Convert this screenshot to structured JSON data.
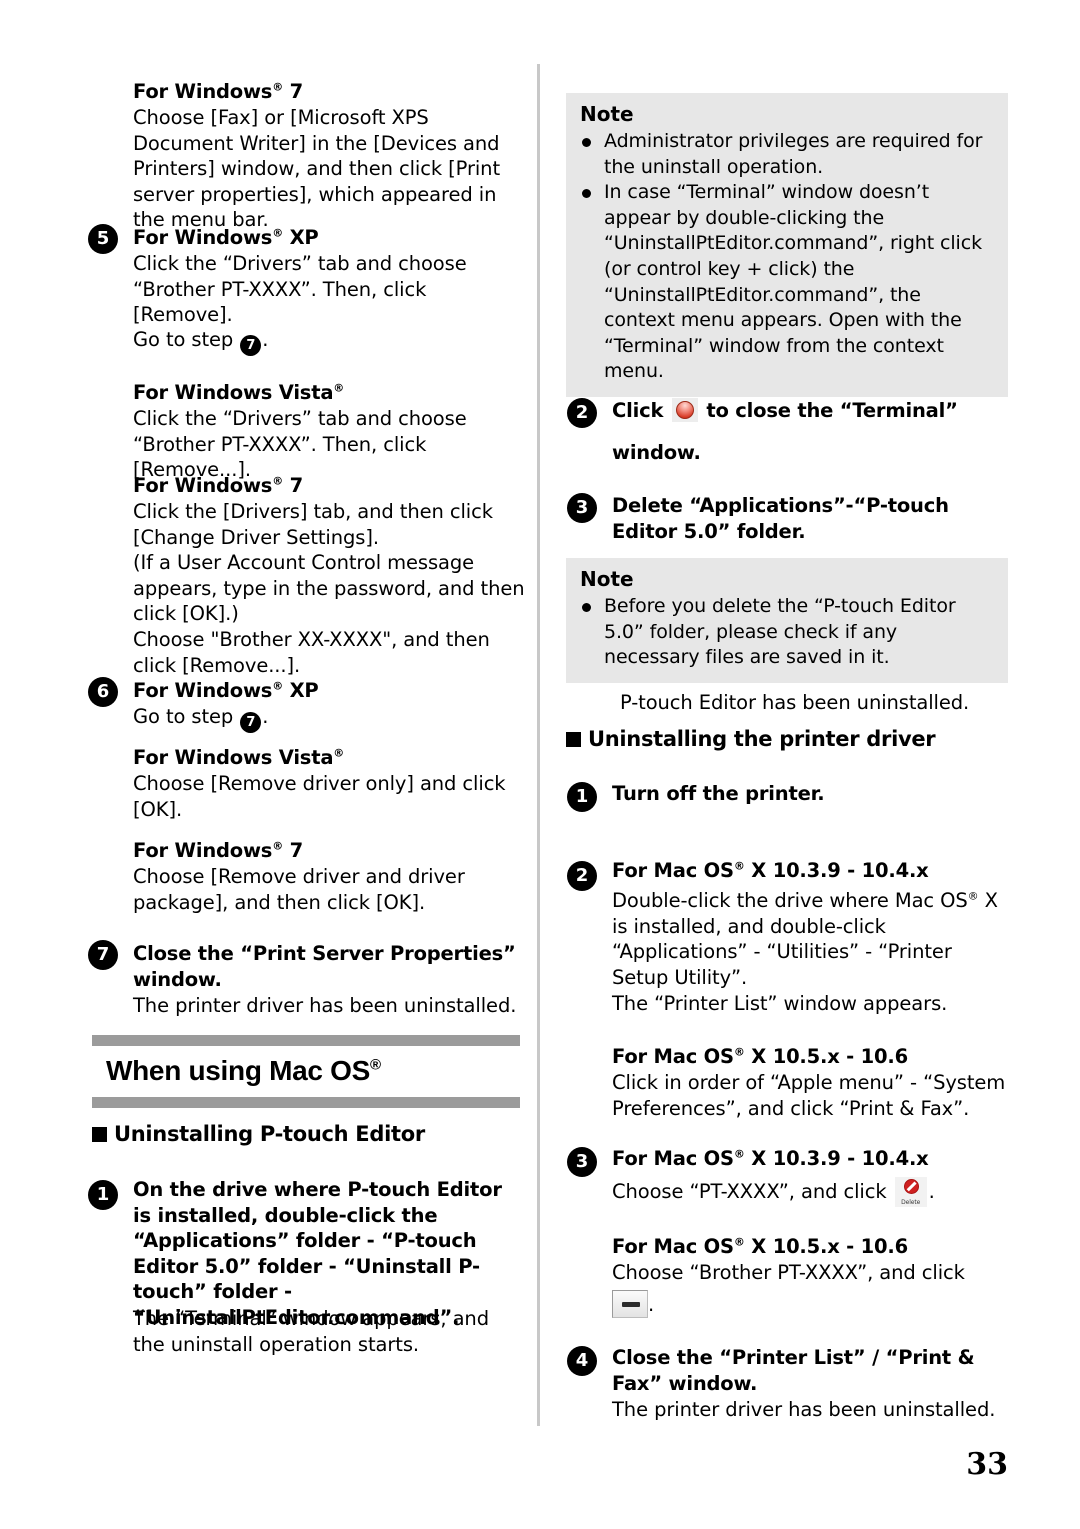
{
  "page": {
    "number": "33"
  },
  "left_column": {
    "win7_first": {
      "heading_pre": "For Windows",
      "heading_reg": "®",
      "heading_post": " 7",
      "body": "Choose [Fax] or [Microsoft XPS Document Writer] in the [Devices and Printers] window, and then click [Print server properties], which appeared in the menu bar."
    },
    "step5": {
      "number": "5",
      "winxp_heading_pre": "For Windows",
      "winxp_heading_post": " XP",
      "winxp_body": "Click the “Drivers” tab and choose “Brother PT-XXXX”. Then, click [Remove].",
      "goto_pre": "Go to step ",
      "goto_step": "7",
      "goto_post": ".",
      "vista_heading_pre": "For Windows Vista",
      "vista_body": "Click the “Drivers” tab and choose “Brother PT-XXXX”. Then, click [Remove...].",
      "win7_heading_pre": "For Windows",
      "win7_heading_post": " 7",
      "win7_body": "Click the [Drivers] tab, and then click [Change Driver Settings].\n(If a User Account Control message appears, type in the password, and then click [OK].)\nChoose \"Brother XX-XXXX\", and then click [Remove...]."
    },
    "step6": {
      "number": "6",
      "winxp_heading_pre": "For Windows",
      "winxp_heading_post": " XP",
      "goto_pre": "Go to step ",
      "goto_step": "7",
      "goto_post": ".",
      "vista_heading_pre": "For Windows Vista",
      "vista_body": "Choose [Remove driver only] and click [OK].",
      "win7_heading_pre": "For Windows",
      "win7_heading_post": " 7",
      "win7_body": "Choose [Remove driver and driver package], and then click [OK]."
    },
    "step7": {
      "number": "7",
      "heading": "Close the “Print Server Properties” window.",
      "body": "The printer driver has been uninstalled."
    },
    "banner": {
      "title_pre": "When using Mac OS",
      "title_reg": "®"
    },
    "section_ptouch": {
      "title": "Uninstalling P-touch Editor"
    },
    "mac_step1": {
      "number": "1",
      "heading": "On the drive where P-touch Editor is installed, double-click the “Applications” folder - “P-touch Editor 5.0” folder - “Uninstall P-touch” folder - “UninstallPtEditor.command”.",
      "body": "The “Terminal” window appears, and the uninstall operation starts."
    }
  },
  "right_column": {
    "note1": {
      "title": "Note",
      "items": [
        "Administrator privileges are required for the uninstall operation.",
        "In case “Terminal” window doesn’t appear by double-clicking the “UninstallPtEditor.command”, right click (or control key + click) the “UninstallPtEditor.command”, the context menu appears. Open with the “Terminal” window from the context menu."
      ]
    },
    "step2": {
      "number": "2",
      "text_pre": "Click ",
      "icon": "mac-close-button-icon",
      "text_mid": " to close the “Terminal”",
      "text_post": "window."
    },
    "step3": {
      "number": "3",
      "heading": "Delete “Applications”-“P-touch Editor 5.0” folder."
    },
    "note2": {
      "title": "Note",
      "items": [
        "Before you delete the “P-touch Editor 5.0” folder, please check if any necessary files are saved in it."
      ]
    },
    "uninstalled_msg": "P-touch Editor has been uninstalled.",
    "section_driver": {
      "title": "Uninstalling the printer driver"
    },
    "drv_step1": {
      "number": "1",
      "heading": "Turn off the printer."
    },
    "drv_step2": {
      "number": "2",
      "mac103_heading_pre": "For Mac OS",
      "mac103_heading_post": " X 10.3.9 - 10.4.x",
      "mac103_body_a": "Double-click the drive where Mac OS",
      "mac103_body_b": " X is installed, and double-click “Applications” - “Utilities” - “Printer Setup Utility”.",
      "mac103_body_c": "The “Printer List” window appears.",
      "mac105_heading_pre": "For Mac OS",
      "mac105_heading_post": " X 10.5.x - 10.6",
      "mac105_body": "Click in order of “Apple menu” - “System Preferences”, and click “Print & Fax”."
    },
    "drv_step3": {
      "number": "3",
      "mac103_heading_pre": "For Mac OS",
      "mac103_heading_post": " X 10.3.9 - 10.4.x",
      "mac103_body_pre": "Choose “PT-XXXX”, and click ",
      "mac103_icon": "delete-toolbar-icon",
      "mac103_icon_label": "Delete",
      "mac103_body_post": ".",
      "mac105_heading_pre": "For Mac OS",
      "mac105_heading_post": " X 10.5.x - 10.6",
      "mac105_body_pre": "Choose “Brother PT-XXXX”, and click",
      "mac105_icon": "minus-button-icon",
      "mac105_body_post": "."
    },
    "drv_step4": {
      "number": "4",
      "heading": "Close the “Printer List” / “Print & Fax” window.",
      "body": "The printer driver has been uninstalled."
    }
  }
}
